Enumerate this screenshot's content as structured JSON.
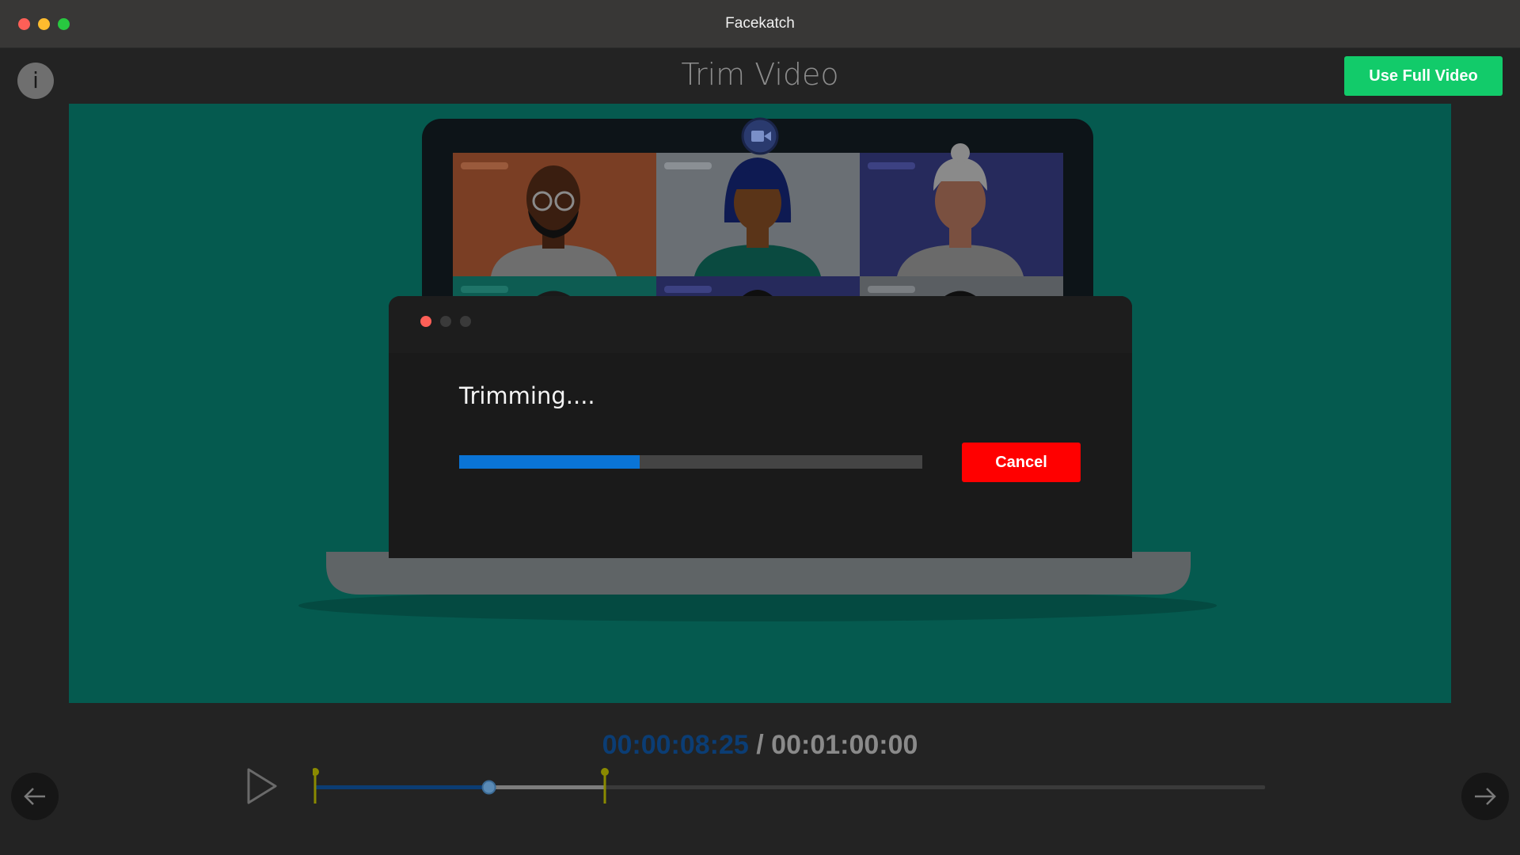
{
  "window": {
    "title": "Facekatch"
  },
  "header": {
    "info_label": "i",
    "title": "Trim Video",
    "use_full_label": "Use Full Video"
  },
  "dialog": {
    "message": "Trimming....",
    "progress_fraction": 0.39,
    "cancel_label": "Cancel"
  },
  "playback": {
    "current_time": "00:00:08:25",
    "separator": "/",
    "total_time": "00:01:00:00",
    "trim_start_fraction": 0.0,
    "trim_end_fraction": 0.305,
    "playhead_fraction": 0.183
  },
  "icons": {
    "info": "info-icon",
    "play": "play-icon",
    "prev": "arrow-left-icon",
    "next": "arrow-right-icon",
    "camera": "video-camera-icon"
  },
  "colors": {
    "accent_green": "#12cb6a",
    "cancel_red": "#ff0000",
    "progress_blue": "#0a74d6",
    "video_bg": "#055a4f",
    "trim_handle": "#8a8a00"
  }
}
